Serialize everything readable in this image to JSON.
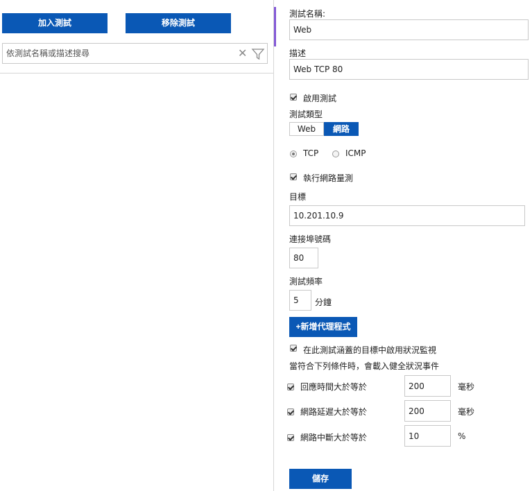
{
  "left": {
    "add_button": "加入測試",
    "remove_button": "移除測試",
    "search": {
      "placeholder": "依測試名稱或描述搜尋"
    }
  },
  "form": {
    "test_name_label": "測試名稱:",
    "test_name_value": "Web",
    "description_label": "描述",
    "description_value": "Web TCP 80",
    "enable_test_label": "啟用測試",
    "test_type_label": "測試類型",
    "type_options": [
      "Web",
      "網路"
    ],
    "type_selected": "網路",
    "protocol_options": [
      "TCP",
      "ICMP"
    ],
    "protocol_selected": "TCP",
    "run_network_measure_label": "執行網路量測",
    "target_label": "目標",
    "target_value": "10.201.10.9",
    "port_label": "連接埠號碼",
    "port_value": "80",
    "frequency_label": "測試頻率",
    "frequency_value": "5",
    "frequency_unit": "分鐘",
    "add_agent_button": "+新增代理程式",
    "health_monitor_label": "在此測試涵蓋的目標中啟用狀況監視",
    "health_condition_text": "當符合下列條件時，會載入健全狀況事件",
    "conditions": [
      {
        "label": "回應時間大於等於",
        "value": "200",
        "unit": "毫秒"
      },
      {
        "label": "網路延遲大於等於",
        "value": "200",
        "unit": "毫秒"
      },
      {
        "label": "網路中斷大於等於",
        "value": "10",
        "unit": "%"
      }
    ],
    "save_button": "儲存"
  },
  "colors": {
    "primary": "#0a58b5",
    "accent": "#8258d6"
  }
}
